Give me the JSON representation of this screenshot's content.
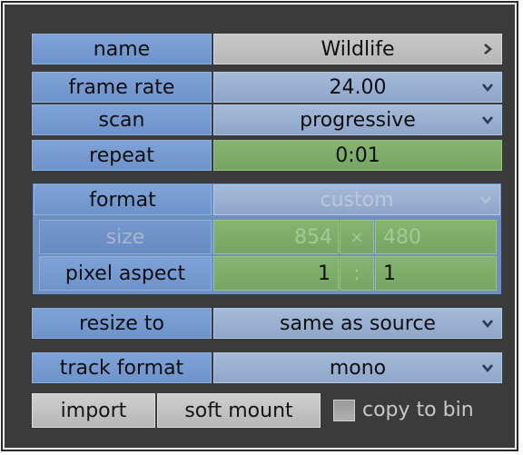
{
  "fields": {
    "name": {
      "label": "name",
      "value": "Wildlife"
    },
    "frame_rate": {
      "label": "frame rate",
      "value": "24.00"
    },
    "scan": {
      "label": "scan",
      "value": "progressive"
    },
    "repeat": {
      "label": "repeat",
      "value": "0:01"
    }
  },
  "format_group": {
    "format": {
      "label": "format",
      "value": "custom"
    },
    "size": {
      "label": "size",
      "width": "854",
      "separator": "×",
      "height": "480"
    },
    "pixel_aspect": {
      "label": "pixel aspect",
      "x": "1",
      "separator": ":",
      "y": "1"
    }
  },
  "resize_to": {
    "label": "resize to",
    "value": "same as source"
  },
  "track_format": {
    "label": "track format",
    "value": "mono"
  },
  "actions": {
    "import_label": "import",
    "soft_mount_label": "soft mount",
    "copy_to_bin_label": "copy to bin",
    "copy_to_bin_checked": false
  },
  "colors": {
    "label_blue": "#7598cc",
    "value_gray": "#c0c0c0",
    "value_blue": "#98afd0",
    "value_green": "#7dad68",
    "panel_bg": "#3b3b3b"
  }
}
